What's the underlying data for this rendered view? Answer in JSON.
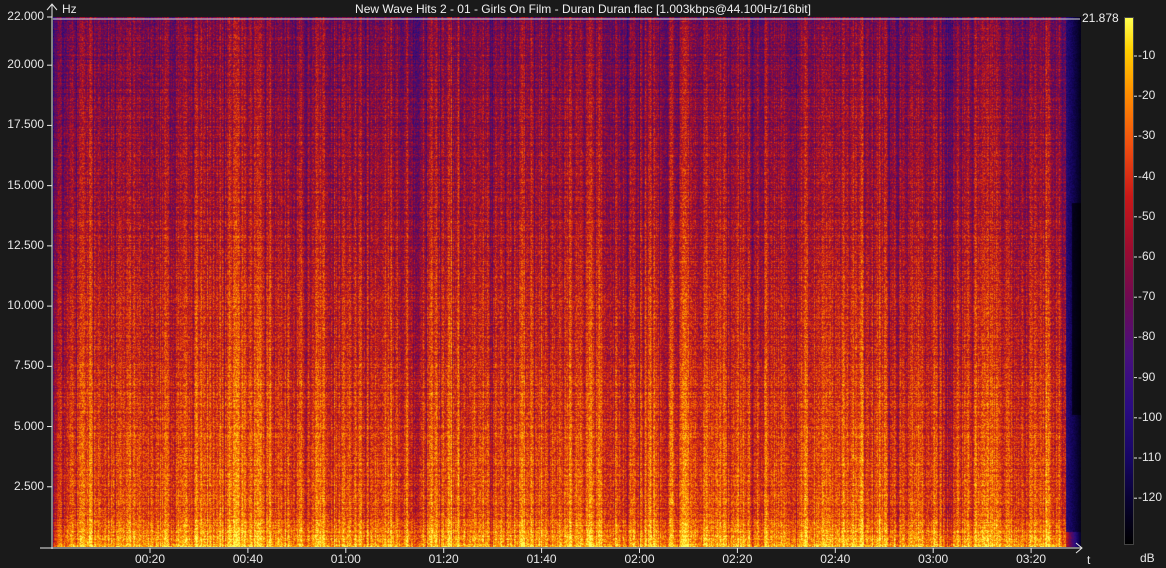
{
  "title": "New Wave Hits 2 - 01 - Girls On Film - Duran Duran.flac [1.003kbps@44.100Hz/16bit]",
  "y_unit": "Hz",
  "x_unit": "t",
  "colorbar_unit": "dB",
  "max_freq_label": "21.878",
  "colors": {
    "background": "#1a1a1a",
    "axis": "#e8e8e8",
    "max_line": "#d0d0d0"
  },
  "chart_data": {
    "type": "heatmap",
    "title": "New Wave Hits 2 - 01 - Girls On Film - Duran Duran.flac [1.003kbps@44.100Hz/16bit]",
    "xlabel": "t",
    "ylabel": "Hz",
    "zlabel": "dB",
    "ylim": [
      0,
      22000
    ],
    "zlim": [
      -120,
      0
    ],
    "max_frequency": 21878,
    "y_ticks": [
      "22.000",
      "20.000",
      "17.500",
      "15.000",
      "12.500",
      "10.000",
      "7.500",
      "5.000",
      "2.500"
    ],
    "y_tick_values": [
      22000,
      20000,
      17500,
      15000,
      12500,
      10000,
      7500,
      5000,
      2500
    ],
    "x_ticks": [
      "00:20",
      "00:40",
      "01:00",
      "01:20",
      "01:40",
      "02:00",
      "02:20",
      "02:40",
      "03:00",
      "03:20"
    ],
    "colorbar_ticks": [
      "-10",
      "-20",
      "-30",
      "-40",
      "-50",
      "-60",
      "-70",
      "-80",
      "-90",
      "-100",
      "-110",
      "-120"
    ]
  }
}
